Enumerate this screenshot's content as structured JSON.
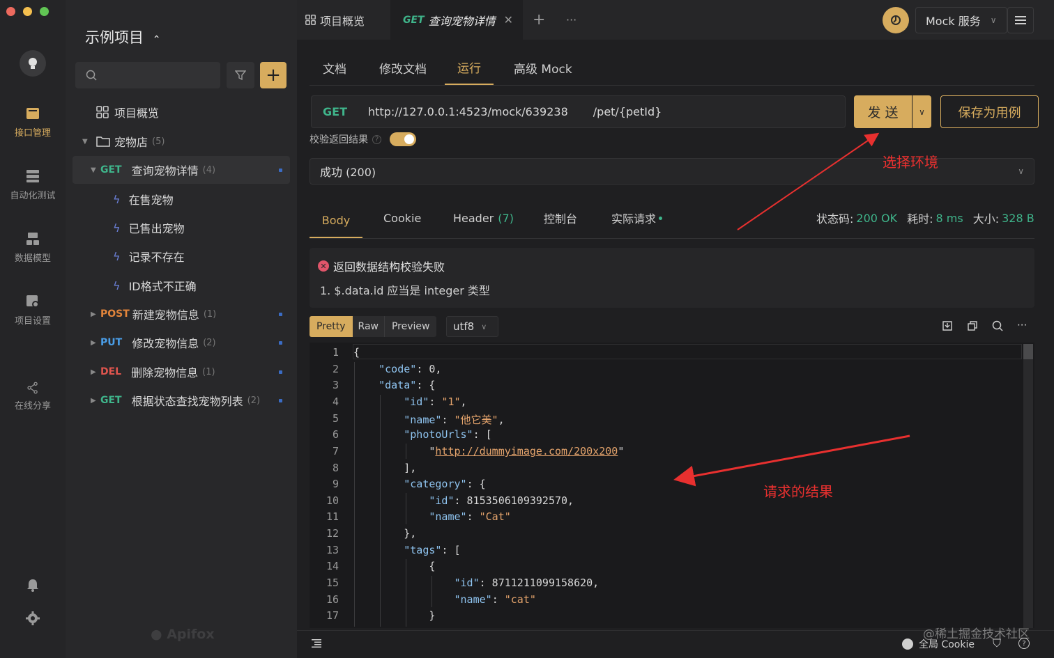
{
  "rail": {
    "items": [
      {
        "label": "接口管理",
        "icon": "api-management-icon"
      },
      {
        "label": "自动化测试",
        "icon": "automation-test-icon"
      },
      {
        "label": "数据模型",
        "icon": "data-model-icon"
      },
      {
        "label": "项目设置",
        "icon": "project-settings-icon"
      },
      {
        "label": "在线分享",
        "icon": "share-icon"
      }
    ]
  },
  "sidebar": {
    "project_name": "示例项目",
    "overview": "项目概览",
    "folder": {
      "label": "宠物店",
      "count": "(5)"
    },
    "items": [
      {
        "method": "GET",
        "label": "查询宠物详情",
        "count": "(4)"
      },
      {
        "method": "POST",
        "label": "新建宠物信息",
        "count": "(1)"
      },
      {
        "method": "PUT",
        "label": "修改宠物信息",
        "count": "(2)"
      },
      {
        "method": "DEL",
        "label": "删除宠物信息",
        "count": "(1)"
      },
      {
        "method": "GET",
        "label": "根据状态查找宠物列表",
        "count": "(2)"
      }
    ],
    "cases": [
      "在售宠物",
      "已售出宠物",
      "记录不存在",
      "ID格式不正确"
    ],
    "watermark": "Apifox"
  },
  "topbar": {
    "tab_overview": "项目概览",
    "tab_active_method": "GET",
    "tab_active_label": "查询宠物详情",
    "env_label": "Mock 服务"
  },
  "subtabs": [
    "文档",
    "修改文档",
    "运行",
    "高级 Mock"
  ],
  "request": {
    "method": "GET",
    "base_url": "http://127.0.0.1:4523/mock/639238",
    "path": "/pet/{petId}",
    "send_label": "发 送",
    "save_label": "保存为用例",
    "validate_label": "校验返回结果",
    "response_select": "成功 (200)"
  },
  "response": {
    "tabs": [
      "Body",
      "Cookie",
      "Header",
      "控制台",
      "实际请求"
    ],
    "header_count": "(7)",
    "status_label": "状态码:",
    "status_value": "200 OK",
    "time_label": "耗时:",
    "time_value": "8 ms",
    "size_label": "大小:",
    "size_value": "328 B",
    "error_title": "返回数据结构校验失败",
    "error_detail": "1. $.data.id 应当是 integer 类型",
    "view_modes": [
      "Pretty",
      "Raw",
      "Preview"
    ],
    "encoding": "utf8"
  },
  "code_lines": [
    "{",
    "    \"code\": 0,",
    "    \"data\": {",
    "        \"id\": \"1\",",
    "        \"name\": \"他它美\",",
    "        \"photoUrls\": [",
    "            \"http://dummyimage.com/200x200\"",
    "        ],",
    "        \"category\": {",
    "            \"id\": 8153506109392570,",
    "            \"name\": \"Cat\"",
    "        },",
    "        \"tags\": [",
    "            {",
    "                \"id\": 8711211099158620,",
    "                \"name\": \"cat\"",
    "            }"
  ],
  "annotations": {
    "env": "选择环境",
    "result": "请求的结果"
  },
  "footer": {
    "cookie_label": "全局 Cookie",
    "watermark": "@稀土掘金技术社区"
  }
}
